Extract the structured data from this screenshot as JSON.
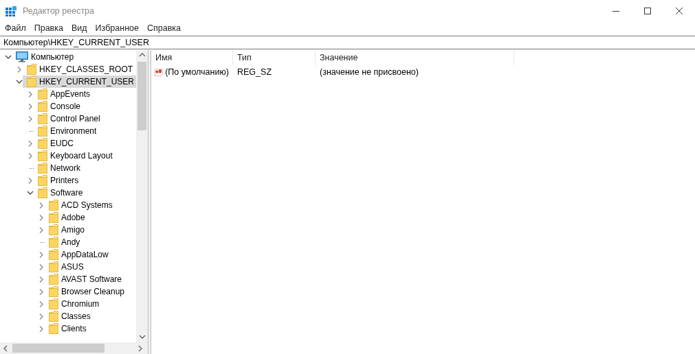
{
  "window": {
    "title": "Редактор реестра"
  },
  "menu": [
    "Файл",
    "Правка",
    "Вид",
    "Избранное",
    "Справка"
  ],
  "address": {
    "value": "Компьютер\\HKEY_CURRENT_USER"
  },
  "tree": [
    {
      "label": "Компьютер",
      "kind": "computer",
      "expandable": true,
      "expanded": true,
      "selected": false,
      "children": [
        {
          "label": "HKEY_CLASSES_ROOT",
          "kind": "folder",
          "expandable": true,
          "expanded": false,
          "selected": false
        },
        {
          "label": "HKEY_CURRENT_USER",
          "kind": "folder",
          "expandable": true,
          "expanded": true,
          "selected": true,
          "children": [
            {
              "label": "AppEvents",
              "kind": "folder",
              "expandable": true,
              "expanded": false,
              "selected": false
            },
            {
              "label": "Console",
              "kind": "folder",
              "expandable": true,
              "expanded": false,
              "selected": false
            },
            {
              "label": "Control Panel",
              "kind": "folder",
              "expandable": true,
              "expanded": false,
              "selected": false
            },
            {
              "label": "Environment",
              "kind": "folder",
              "expandable": false,
              "selected": false
            },
            {
              "label": "EUDC",
              "kind": "folder",
              "expandable": true,
              "expanded": false,
              "selected": false
            },
            {
              "label": "Keyboard Layout",
              "kind": "folder",
              "expandable": true,
              "expanded": false,
              "selected": false
            },
            {
              "label": "Network",
              "kind": "folder",
              "expandable": false,
              "selected": false
            },
            {
              "label": "Printers",
              "kind": "folder",
              "expandable": true,
              "expanded": false,
              "selected": false
            },
            {
              "label": "Software",
              "kind": "folder",
              "expandable": true,
              "expanded": true,
              "selected": false,
              "children": [
                {
                  "label": "ACD Systems",
                  "kind": "folder",
                  "expandable": true,
                  "expanded": false,
                  "selected": false
                },
                {
                  "label": "Adobe",
                  "kind": "folder",
                  "expandable": true,
                  "expanded": false,
                  "selected": false
                },
                {
                  "label": "Amigo",
                  "kind": "folder",
                  "expandable": true,
                  "expanded": false,
                  "selected": false
                },
                {
                  "label": "Andy",
                  "kind": "folder",
                  "expandable": false,
                  "selected": false
                },
                {
                  "label": "AppDataLow",
                  "kind": "folder",
                  "expandable": true,
                  "expanded": false,
                  "selected": false
                },
                {
                  "label": "ASUS",
                  "kind": "folder",
                  "expandable": true,
                  "expanded": false,
                  "selected": false
                },
                {
                  "label": "AVAST Software",
                  "kind": "folder",
                  "expandable": true,
                  "expanded": false,
                  "selected": false
                },
                {
                  "label": "Browser Cleanup",
                  "kind": "folder",
                  "expandable": true,
                  "expanded": false,
                  "selected": false
                },
                {
                  "label": "Chromium",
                  "kind": "folder",
                  "expandable": true,
                  "expanded": false,
                  "selected": false
                },
                {
                  "label": "Classes",
                  "kind": "folder",
                  "expandable": true,
                  "expanded": false,
                  "selected": false
                },
                {
                  "label": "Clients",
                  "kind": "folder",
                  "expandable": true,
                  "expanded": false,
                  "selected": false
                }
              ]
            }
          ]
        }
      ]
    }
  ],
  "table": {
    "columns": [
      "Имя",
      "Тип",
      "Значение"
    ],
    "rows": [
      {
        "kind": "string",
        "name": "(По умолчанию)",
        "type": "REG_SZ",
        "value": "(значение не присвоено)"
      }
    ]
  }
}
